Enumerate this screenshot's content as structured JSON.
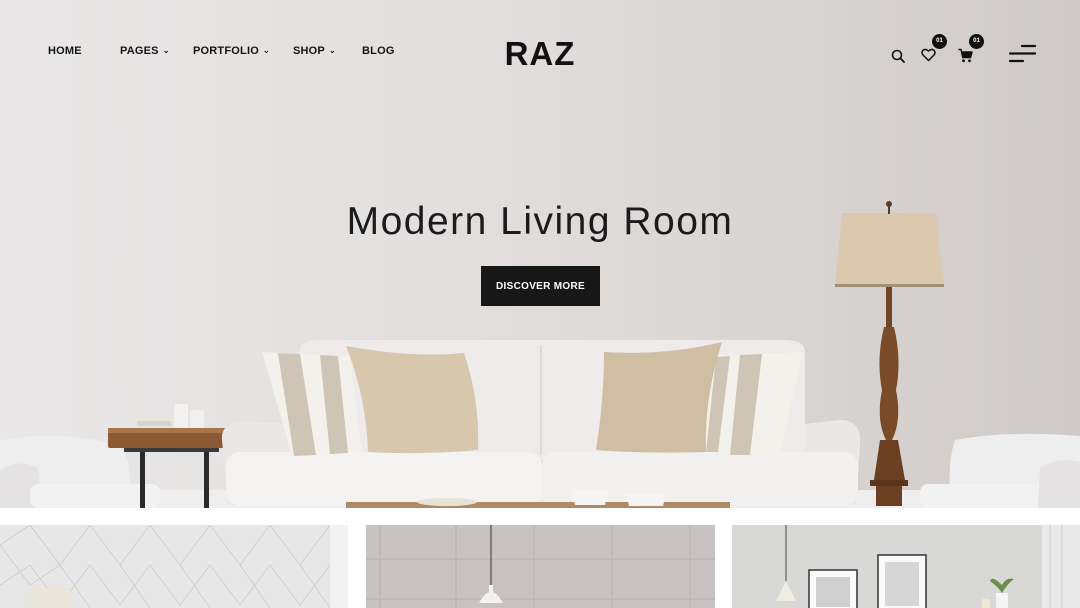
{
  "nav": {
    "items": [
      {
        "label": "HOME",
        "has_dropdown": false
      },
      {
        "label": "PAGES",
        "has_dropdown": true
      },
      {
        "label": "PORTFOLIO",
        "has_dropdown": true
      },
      {
        "label": "SHOP",
        "has_dropdown": true
      },
      {
        "label": "BLOG",
        "has_dropdown": false
      }
    ]
  },
  "logo": "RAZ",
  "tools": {
    "search_icon": "search-icon",
    "wishlist_icon": "heart-icon",
    "wishlist_count": "01",
    "cart_icon": "cart-icon",
    "cart_count": "01",
    "menu_icon": "hamburger-menu-icon"
  },
  "hero": {
    "title": "Modern Living Room",
    "button_label": "DISCOVER MORE"
  },
  "colors": {
    "accent": "#171717",
    "button_text": "#ffffff",
    "hero_background": "#e4e1e0"
  },
  "cards": [
    {
      "name": "category-card-lamp"
    },
    {
      "name": "category-card-pendant"
    },
    {
      "name": "category-card-gallery"
    }
  ]
}
